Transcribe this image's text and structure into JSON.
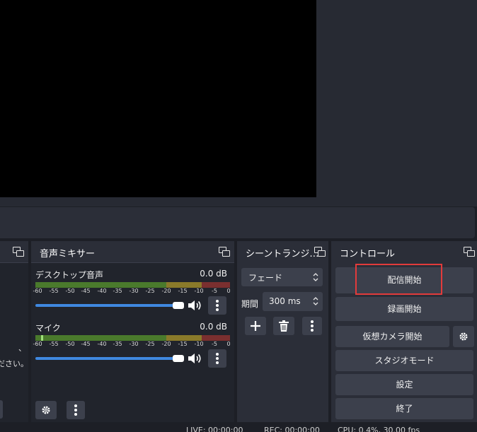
{
  "mixer": {
    "title": "音声ミキサー",
    "ticks": [
      "-60",
      "-55",
      "-50",
      "-45",
      "-40",
      "-35",
      "-30",
      "-25",
      "-20",
      "-15",
      "-10",
      "-5",
      "0"
    ],
    "channels": [
      {
        "name": "デスクトップ音声",
        "db": "0.0 dB"
      },
      {
        "name": "マイク",
        "db": "0.0 dB"
      }
    ]
  },
  "sources": {
    "partial_text": [
      "、",
      "ください。"
    ]
  },
  "transitions": {
    "title": "シーントランジ…",
    "selected": "フェード",
    "duration_label": "期間",
    "duration_value": "300 ms"
  },
  "controls": {
    "title": "コントロール",
    "start_streaming": "配信開始",
    "start_recording": "録画開始",
    "start_virtual_camera": "仮想カメラ開始",
    "studio_mode": "スタジオモード",
    "settings": "設定",
    "exit": "終了"
  },
  "status": {
    "live": "LIVE: 00:00:00",
    "rec": "REC: 00:00:00",
    "cpu": "CPU: 0.4%, 30.00 fps"
  },
  "colors": {
    "meter_green": "#4a7a2c",
    "meter_yellow": "#8a7a2a",
    "meter_red": "#7a2f2f",
    "slider": "#3f88e0",
    "highlight": "#e23b3b"
  }
}
